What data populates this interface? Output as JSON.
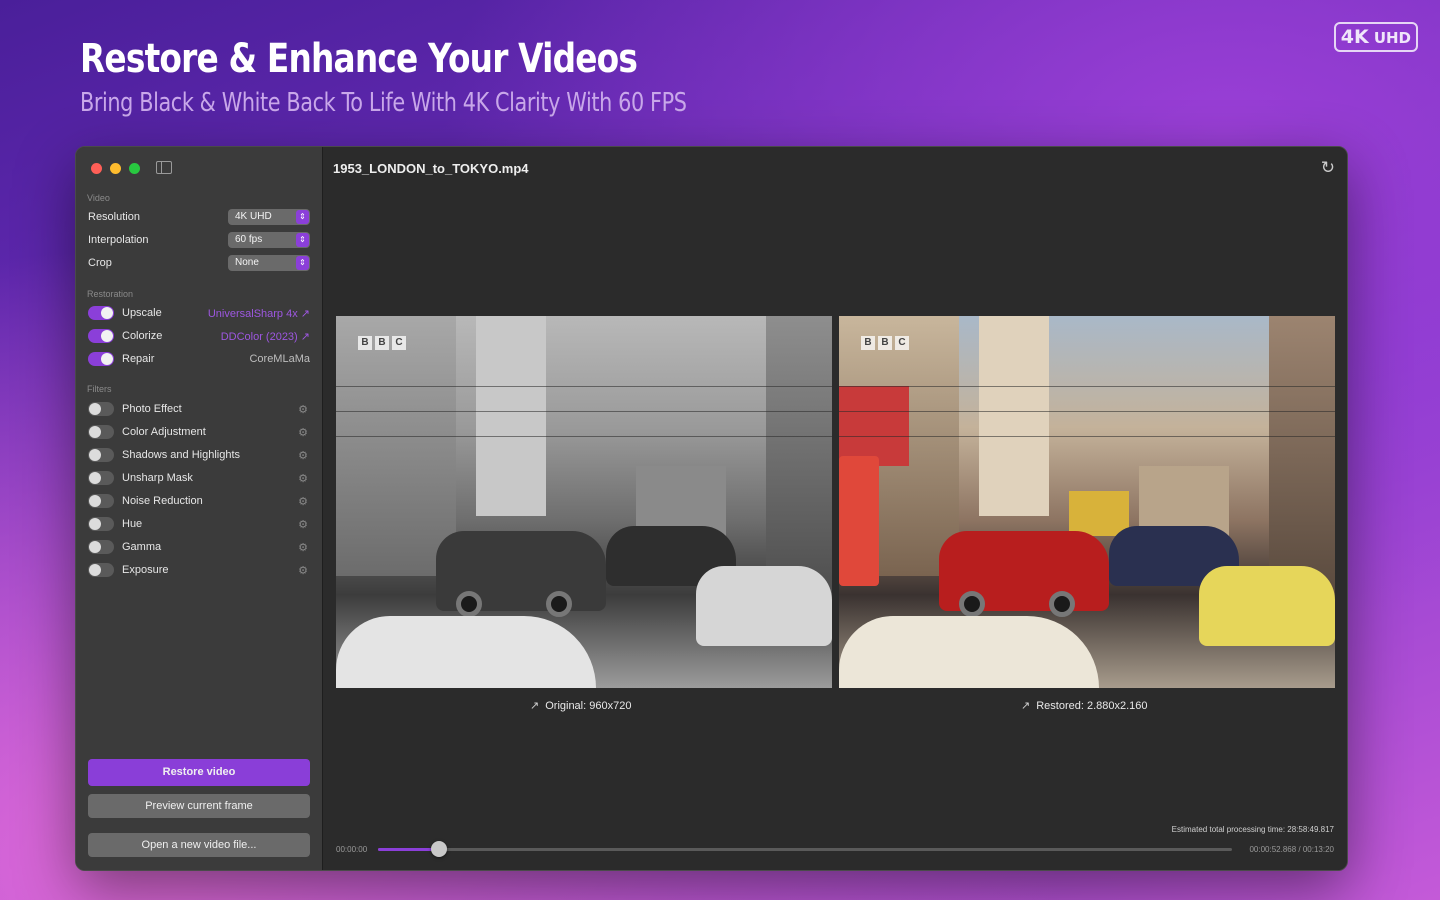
{
  "hero": {
    "title": "Restore & Enhance Your Videos",
    "subtitle": "Bring Black & White Back To Life With 4K Clarity With 60 FPS",
    "badge_big": "4K",
    "badge_small": "UHD"
  },
  "sidebar": {
    "video_section": "Video",
    "video_rows": [
      {
        "label": "Resolution",
        "value": "4K UHD"
      },
      {
        "label": "Interpolation",
        "value": "60 fps"
      },
      {
        "label": "Crop",
        "value": "None"
      }
    ],
    "restoration_section": "Restoration",
    "restoration_rows": [
      {
        "label": "Upscale",
        "model": "UniversalSharp 4x ↗",
        "enabled": true
      },
      {
        "label": "Colorize",
        "model": "DDColor (2023) ↗",
        "enabled": true
      },
      {
        "label": "Repair",
        "model": "CoreMLaMa",
        "enabled": true
      }
    ],
    "filters_section": "Filters",
    "filters": [
      {
        "label": "Photo Effect",
        "enabled": false
      },
      {
        "label": "Color Adjustment",
        "enabled": false
      },
      {
        "label": "Shadows and Highlights",
        "enabled": false
      },
      {
        "label": "Unsharp Mask",
        "enabled": false
      },
      {
        "label": "Noise Reduction",
        "enabled": false
      },
      {
        "label": "Hue",
        "enabled": false
      },
      {
        "label": "Gamma",
        "enabled": false
      },
      {
        "label": "Exposure",
        "enabled": false
      }
    ],
    "restore_button": "Restore video",
    "preview_button": "Preview current frame",
    "open_button": "Open a new video file..."
  },
  "content": {
    "file_name": "1953_LONDON_to_TOKYO.mp4",
    "original_caption": "Original: 960x720",
    "restored_caption": "Restored: 2.880x2.160",
    "logo_letters": [
      "B",
      "B",
      "C"
    ],
    "estimated_time": "Estimated total processing time: 28:58:49.817",
    "time_start": "00:00:00",
    "time_current": "00:00:52.868 / 00:13:20",
    "playback_progress": 0.072
  },
  "colors": {
    "accent": "#8b3fd9",
    "link": "#9d57e0"
  },
  "icons": {
    "refresh": "refresh-icon",
    "gear": "gear-icon",
    "expand": "expand-arrow-icon"
  }
}
